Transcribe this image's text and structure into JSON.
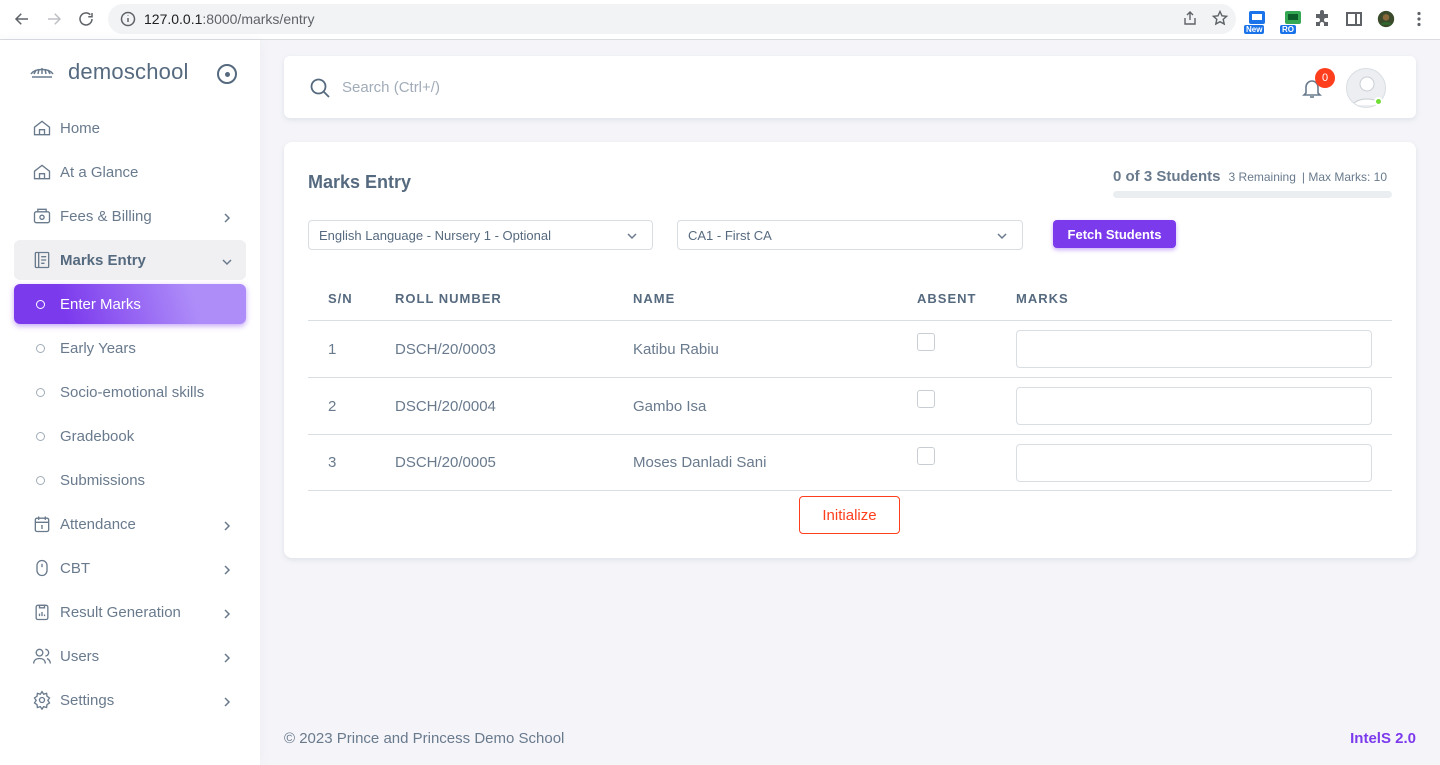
{
  "browser": {
    "url_host": "127.0.0.1",
    "url_path": ":8000/marks/entry",
    "ext_badges": [
      "New",
      "RO"
    ]
  },
  "sidebar": {
    "brand": "demoschool",
    "items": [
      {
        "label": "Home",
        "icon": "home-icon"
      },
      {
        "label": "At a Glance",
        "icon": "home-icon"
      },
      {
        "label": "Fees & Billing",
        "icon": "wallet-icon",
        "chevron": true
      },
      {
        "label": "Marks Entry",
        "icon": "document-icon",
        "open": true
      },
      {
        "label": "Attendance",
        "icon": "calendar-icon",
        "chevron": true
      },
      {
        "label": "CBT",
        "icon": "mouse-icon",
        "chevron": true
      },
      {
        "label": "Result Generation",
        "icon": "clipboard-icon",
        "chevron": true
      },
      {
        "label": "Users",
        "icon": "users-icon",
        "chevron": true
      },
      {
        "label": "Settings",
        "icon": "gear-icon",
        "chevron": true
      }
    ],
    "subitems": [
      {
        "label": "Enter Marks",
        "active": true
      },
      {
        "label": "Early Years"
      },
      {
        "label": "Socio-emotional skills"
      },
      {
        "label": "Gradebook"
      },
      {
        "label": "Submissions"
      }
    ]
  },
  "navbar": {
    "search_placeholder": "Search (Ctrl+/)",
    "notification_count": "0"
  },
  "card": {
    "title": "Marks Entry",
    "progress_main": "0 of 3 Students",
    "progress_remaining": "3 Remaining",
    "progress_max": "| Max Marks: 10",
    "progress_fraction": 0,
    "subject_select": "English Language - Nursery 1 - Optional",
    "assessment_select": "CA1 - First CA",
    "fetch_button": "Fetch Students",
    "initialize_button": "Initialize"
  },
  "table": {
    "headers": {
      "sn": "S/N",
      "roll": "ROLL NUMBER",
      "name": "NAME",
      "absent": "ABSENT",
      "marks": "MARKS"
    },
    "rows": [
      {
        "sn": "1",
        "roll": "DSCH/20/0003",
        "name": "Katibu Rabiu"
      },
      {
        "sn": "2",
        "roll": "DSCH/20/0004",
        "name": "Gambo Isa"
      },
      {
        "sn": "3",
        "roll": "DSCH/20/0005",
        "name": "Moses Danladi Sani"
      }
    ]
  },
  "footer": {
    "copyright": "© 2023 Prince and Princess Demo School",
    "brand": "IntelS 2.0"
  },
  "colors": {
    "accent": "#7c3aed",
    "danger": "#ff3e1d",
    "online": "#71dd37"
  }
}
